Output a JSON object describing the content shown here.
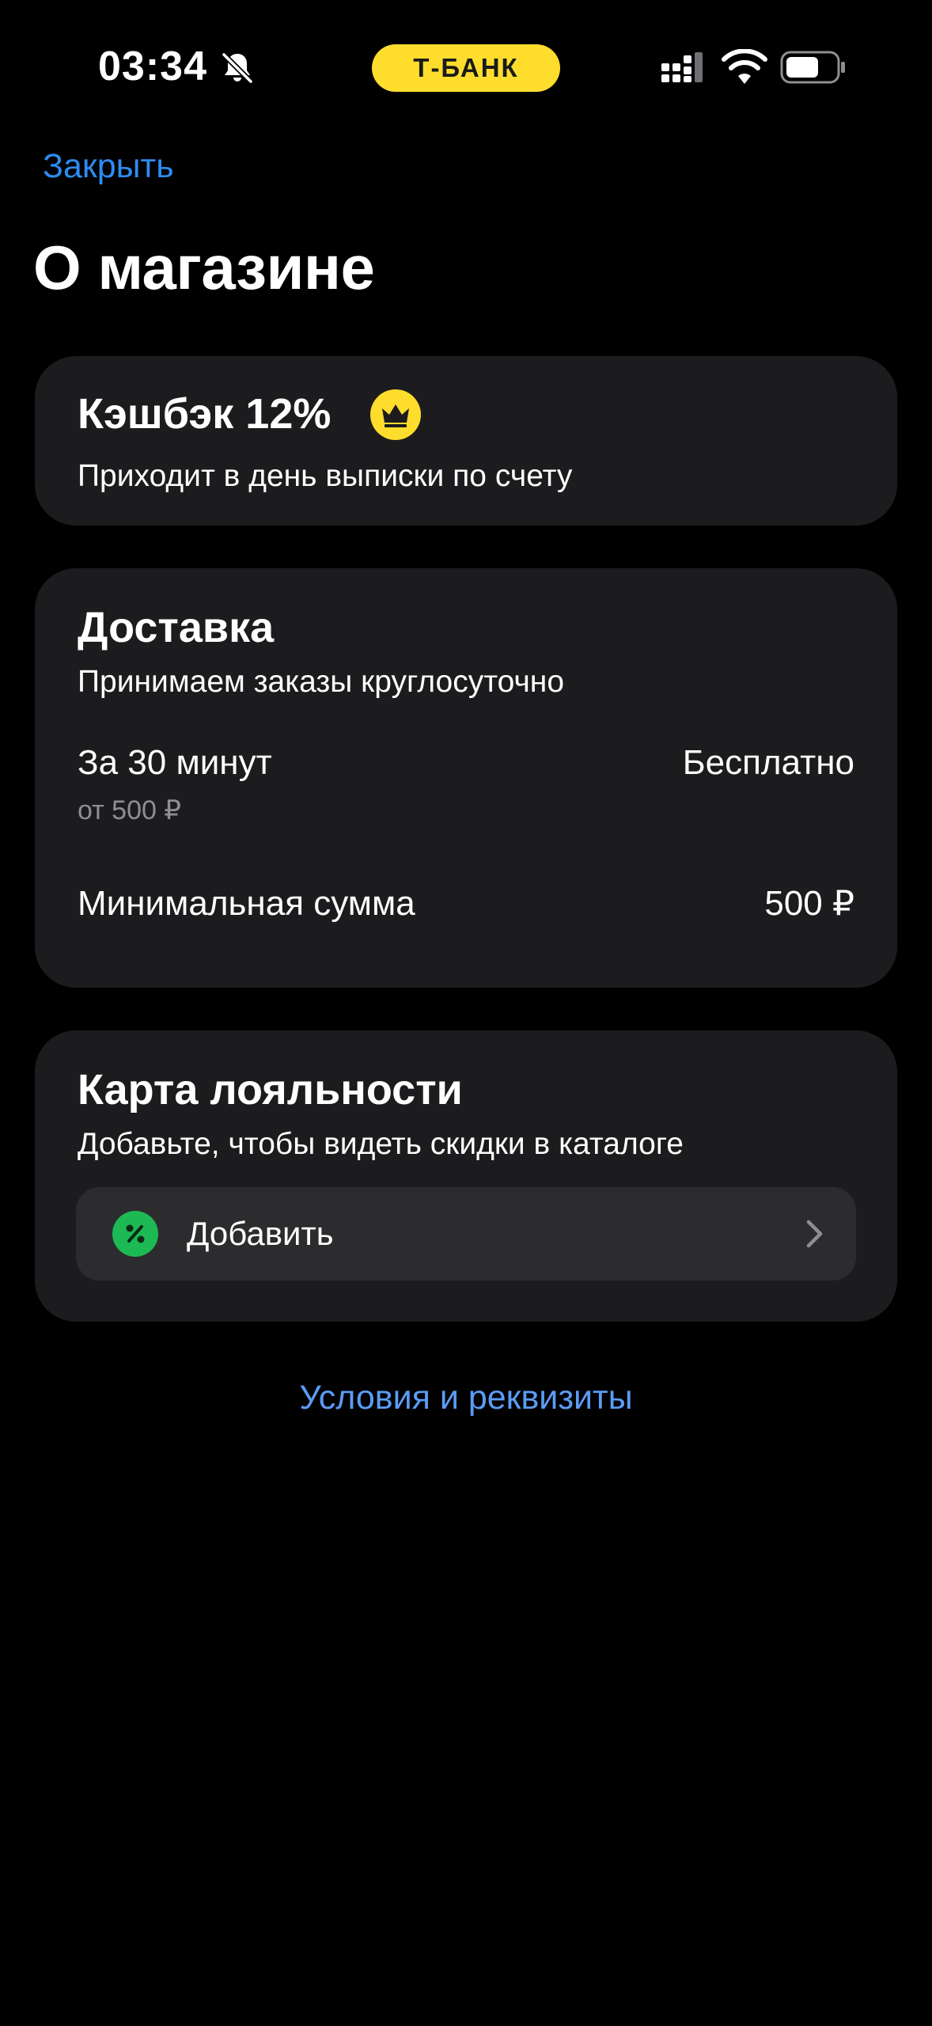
{
  "status_bar": {
    "time": "03:34",
    "brand": "Т-БАНК",
    "icons": [
      "bell-slash-icon",
      "cellular-signal-icon",
      "wifi-icon",
      "battery-icon"
    ]
  },
  "header": {
    "close_label": "Закрыть",
    "title": "О магазине"
  },
  "cashback": {
    "title": "Кэшбэк 12%",
    "badge_icon": "crown-icon",
    "description": "Приходит в день выписки по счету"
  },
  "delivery": {
    "title": "Доставка",
    "subtitle": "Принимаем заказы круглосуточно",
    "time_label": "За 30 минут",
    "time_price": "Бесплатно",
    "time_condition": "от 500 ₽",
    "min_sum_label": "Минимальная сумма",
    "min_sum_value": "500 ₽"
  },
  "loyalty": {
    "title": "Карта лояльности",
    "subtitle": "Добавьте, чтобы видеть скидки в каталоге",
    "add_label": "Добавить",
    "add_icon": "percent-icon"
  },
  "footer": {
    "terms_label": "Условия и реквизиты"
  },
  "colors": {
    "background": "#000000",
    "card": "#1c1c1e",
    "accent_yellow": "#ffdd2d",
    "link_blue": "#2d8cf0",
    "success_green": "#1db954"
  }
}
